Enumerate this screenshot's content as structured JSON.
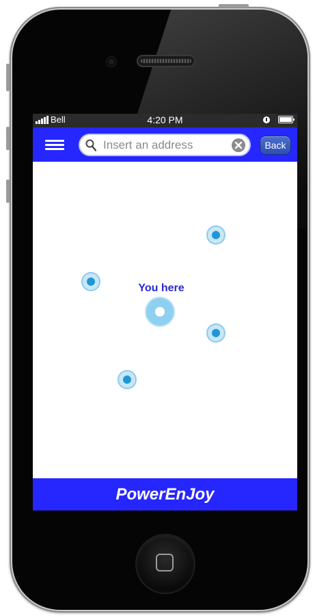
{
  "status_bar": {
    "carrier": "Bell",
    "time": "4:20 PM"
  },
  "header": {
    "search": {
      "placeholder": "Insert an address",
      "value": ""
    },
    "back_label": "Back"
  },
  "map": {
    "current_location_label": "You here",
    "marker_color": "#1f97d6",
    "current_location_color": "#8fd0f0"
  },
  "footer": {
    "app_name": "PowerEnJoy"
  },
  "colors": {
    "brand_blue": "#2626ff",
    "status_bar": "#2b2b2b"
  }
}
